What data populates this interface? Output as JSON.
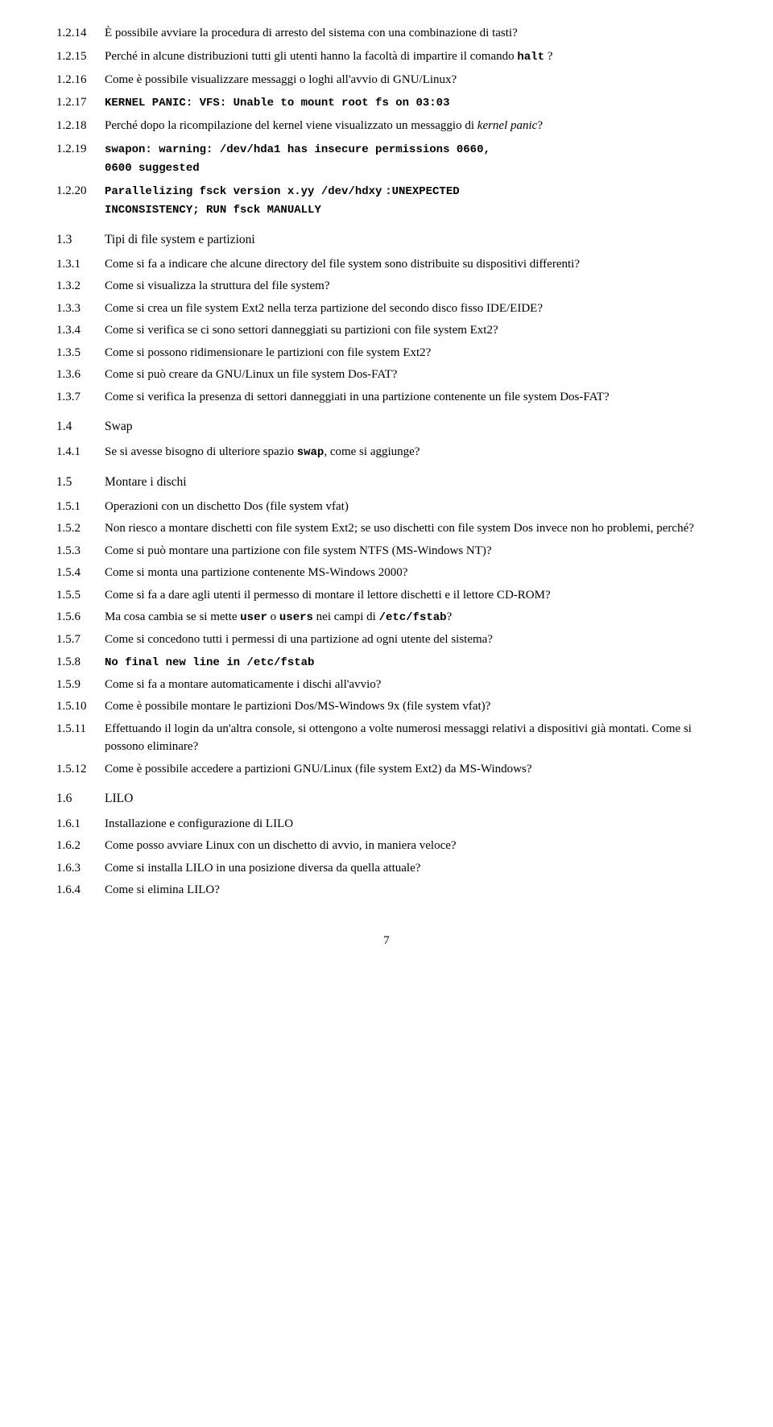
{
  "page_number": "7",
  "entries": [
    {
      "id": "e1214",
      "num": "1.2.14",
      "text": "È possibile avviare la procedura di arresto del sistema con una combinazione di tasti?"
    },
    {
      "id": "e1215",
      "num": "1.2.15",
      "text_parts": [
        {
          "type": "text",
          "content": "Perché in alcune distribuzioni tutti gli utenti hanno la facoltà di impartire il comando "
        },
        {
          "type": "bold_mono",
          "content": "halt"
        },
        {
          "type": "text",
          "content": " ?"
        }
      ]
    },
    {
      "id": "e1216",
      "num": "1.2.16",
      "text": "Come è possibile visualizzare messaggi o loghi all'avvio di GNU/Linux?"
    },
    {
      "id": "e1217",
      "num": "1.2.17",
      "text_parts": [
        {
          "type": "bold_mono",
          "content": "KERNEL PANIC: VFS: Unable to mount root fs on 03:03"
        }
      ]
    },
    {
      "id": "e1218",
      "num": "1.2.18",
      "text_parts": [
        {
          "type": "text",
          "content": "Perché dopo la ricompilazione del kernel viene visualizzato un messaggio di "
        },
        {
          "type": "italic",
          "content": "kernel panic"
        },
        {
          "type": "text",
          "content": "?"
        }
      ]
    },
    {
      "id": "e1219",
      "num": "1.2.19",
      "text_parts": [
        {
          "type": "bold_mono",
          "content": "swapon: warning: /dev/hda1 has insecure permissions 0660, 0600 suggested"
        }
      ]
    },
    {
      "id": "e1220",
      "num": "1.2.20",
      "text_parts": [
        {
          "type": "bold_mono",
          "content": "Parallelizing fsck version x.yy /dev/hdxy"
        },
        {
          "type": "text",
          "content": " "
        },
        {
          "type": "bold_mono",
          "content": ":UNEXPECTED INCONSISTENCY; RUN fsck MANUALLY"
        }
      ]
    }
  ],
  "section_13": {
    "num": "1.3",
    "label": "Tipi di file system e partizioni"
  },
  "entries_13": [
    {
      "num": "1.3.1",
      "text": "Come si fa a indicare che alcune directory del file system sono distribuite su dispositivi differenti?"
    },
    {
      "num": "1.3.2",
      "text": "Come si visualizza la struttura del file system?"
    },
    {
      "num": "1.3.3",
      "text": "Come si crea un file system Ext2 nella terza partizione del secondo disco fisso IDE/EIDE?"
    },
    {
      "num": "1.3.4",
      "text": "Come si verifica se ci sono settori danneggiati su partizioni con file system Ext2?"
    },
    {
      "num": "1.3.5",
      "text": "Come si possono ridimensionare le partizioni con file system Ext2?"
    },
    {
      "num": "1.3.6",
      "text": "Come si può creare da GNU/Linux un file system Dos-FAT?"
    },
    {
      "num": "1.3.7",
      "text": "Come si verifica la presenza di settori danneggiati in una partizione contenente un file system Dos-FAT?"
    }
  ],
  "section_14": {
    "num": "1.4",
    "label": "Swap"
  },
  "entries_14": [
    {
      "num": "1.4.1",
      "text_parts": [
        {
          "type": "text",
          "content": "Se si avesse bisogno di ulteriore spazio "
        },
        {
          "type": "bold_mono",
          "content": "swap"
        },
        {
          "type": "text",
          "content": ", come si aggiunge?"
        }
      ]
    }
  ],
  "section_15": {
    "num": "1.5",
    "label": "Montare i dischi"
  },
  "entries_15": [
    {
      "num": "1.5.1",
      "text": "Operazioni con un dischetto Dos (file system vfat)"
    },
    {
      "num": "1.5.2",
      "text": "Non riesco a montare dischetti con file system Ext2; se uso dischetti con file system Dos invece non ho problemi, perché?"
    },
    {
      "num": "1.5.3",
      "text": "Come si può montare una partizione con file system NTFS (MS-Windows NT)?"
    },
    {
      "num": "1.5.4",
      "text": "Come si monta una partizione contenente MS-Windows 2000?"
    },
    {
      "num": "1.5.5",
      "text": "Come si fa a dare agli utenti il permesso di montare il lettore dischetti e il lettore CD-ROM?"
    },
    {
      "num": "1.5.6",
      "text_parts": [
        {
          "type": "text",
          "content": "Ma cosa cambia se si mette "
        },
        {
          "type": "bold_mono",
          "content": "user"
        },
        {
          "type": "text",
          "content": " o "
        },
        {
          "type": "bold_mono",
          "content": "users"
        },
        {
          "type": "text",
          "content": " nei campi di "
        },
        {
          "type": "bold_mono",
          "content": "/etc/fstab"
        },
        {
          "type": "text",
          "content": "?"
        }
      ]
    },
    {
      "num": "1.5.7",
      "text": "Come si concedono tutti i permessi di una partizione ad ogni utente del sistema?"
    },
    {
      "num": "1.5.8",
      "text_parts": [
        {
          "type": "bold_mono",
          "content": "No final new line in /etc/fstab"
        }
      ]
    },
    {
      "num": "1.5.9",
      "text": "Come si fa a montare automaticamente i dischi all'avvio?"
    },
    {
      "num": "1.5.10",
      "text": "Come è possibile montare le partizioni Dos/MS-Windows 9x (file system vfat)?"
    },
    {
      "num": "1.5.11",
      "text": "Effettuando il login da un'altra console, si ottengono a volte numerosi messaggi relativi a dispositivi già montati. Come si possono eliminare?"
    },
    {
      "num": "1.5.12",
      "text": "Come è possibile accedere a partizioni GNU/Linux (file system Ext2) da MS-Windows?"
    }
  ],
  "section_16": {
    "num": "1.6",
    "label": "LILO"
  },
  "entries_16": [
    {
      "num": "1.6.1",
      "text": "Installazione e configurazione di LILO"
    },
    {
      "num": "1.6.2",
      "text": "Come posso avviare Linux con un dischetto di avvio, in maniera veloce?"
    },
    {
      "num": "1.6.3",
      "text": "Come si installa LILO in una posizione diversa da quella attuale?"
    },
    {
      "num": "1.6.4",
      "text": "Come si elimina LILO?"
    }
  ]
}
